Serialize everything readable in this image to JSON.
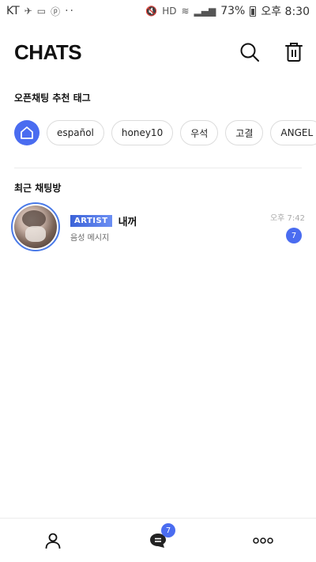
{
  "status_bar": {
    "carrier": "KT",
    "notif_dots": "··",
    "battery": "73%",
    "time": "오후 8:30"
  },
  "header": {
    "title": "CHATS"
  },
  "tags_section": {
    "label": "오픈채팅 추천 태그",
    "tags": [
      "español",
      "honey10",
      "우석",
      "고결",
      "ANGEL"
    ]
  },
  "recent_section": {
    "label": "최근 채팅방",
    "chats": [
      {
        "badge": "ARTIST",
        "name": "내꺼",
        "preview": "음성 메시지",
        "time": "오후 7:42",
        "unread": "7"
      }
    ]
  },
  "bottom_nav": {
    "chats_badge": "7"
  },
  "colors": {
    "accent": "#4a6cf0",
    "badge_gradient_start": "#3c63d8",
    "badge_gradient_end": "#6b8ef3"
  },
  "icons": {
    "search": "search-icon",
    "trash": "trash-icon",
    "home": "home-icon",
    "profile": "person-icon",
    "chats": "chat-bubble-icon",
    "more": "more-dots-icon"
  }
}
